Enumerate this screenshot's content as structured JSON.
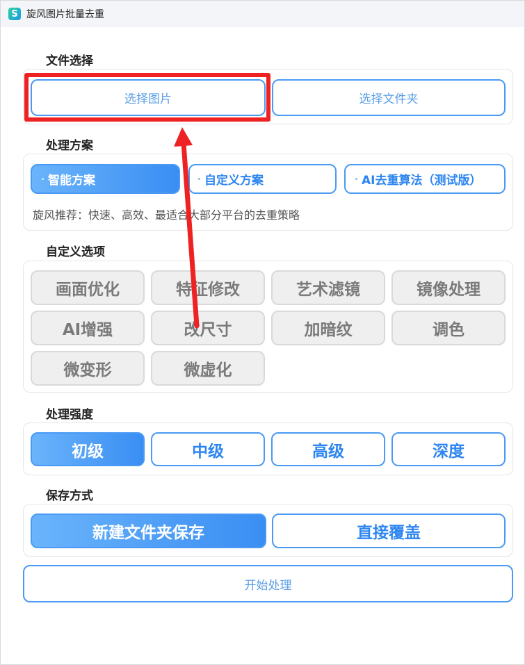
{
  "window": {
    "title": "旋风图片批量去重",
    "icon": "app-logo-icon",
    "icon_glyph": "S"
  },
  "file_select": {
    "label": "文件选择",
    "select_images": "选择图片",
    "select_folder": "选择文件夹"
  },
  "plan": {
    "label": "处理方案",
    "options": [
      "智能方案",
      "自定义方案",
      "AI去重算法（测试版）"
    ],
    "selected": "智能方案",
    "recommendation": "旋风推荐：快速、高效、最适合大部分平台的去重策略"
  },
  "custom": {
    "label": "自定义选项",
    "options": [
      "画面优化",
      "特征修改",
      "艺术滤镜",
      "镜像处理",
      "AI增强",
      "改尺寸",
      "加暗纹",
      "调色",
      "微变形",
      "微虚化"
    ]
  },
  "strength": {
    "label": "处理强度",
    "options": [
      "初级",
      "中级",
      "高级",
      "深度"
    ],
    "selected": "初级"
  },
  "save": {
    "label": "保存方式",
    "options": [
      "新建文件夹保存",
      "直接覆盖"
    ],
    "selected": "新建文件夹保存"
  },
  "start_button": "开始处理",
  "colors": {
    "accent": "#4a9af5",
    "annotation": "#ee2222",
    "disabled": "#efefef"
  }
}
